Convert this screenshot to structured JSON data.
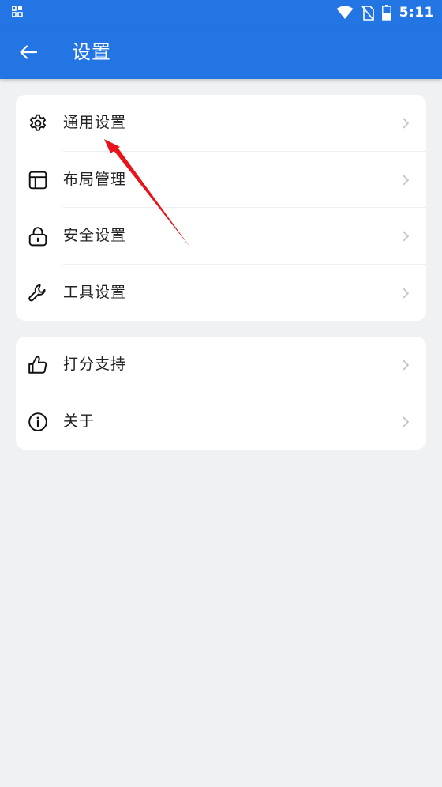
{
  "status_bar": {
    "time": "5:11"
  },
  "app_bar": {
    "title": "设置"
  },
  "groups": [
    {
      "items": [
        {
          "label": "通用设置",
          "icon": "gear-icon"
        },
        {
          "label": "布局管理",
          "icon": "layout-icon"
        },
        {
          "label": "安全设置",
          "icon": "lock-icon"
        },
        {
          "label": "工具设置",
          "icon": "wrench-icon"
        }
      ]
    },
    {
      "items": [
        {
          "label": "打分支持",
          "icon": "thumbs-up-icon"
        },
        {
          "label": "关于",
          "icon": "info-icon"
        }
      ]
    }
  ],
  "colors": {
    "primary": "#2375e4",
    "background": "#f0f1f3",
    "annotation_arrow": "#e8141c"
  }
}
